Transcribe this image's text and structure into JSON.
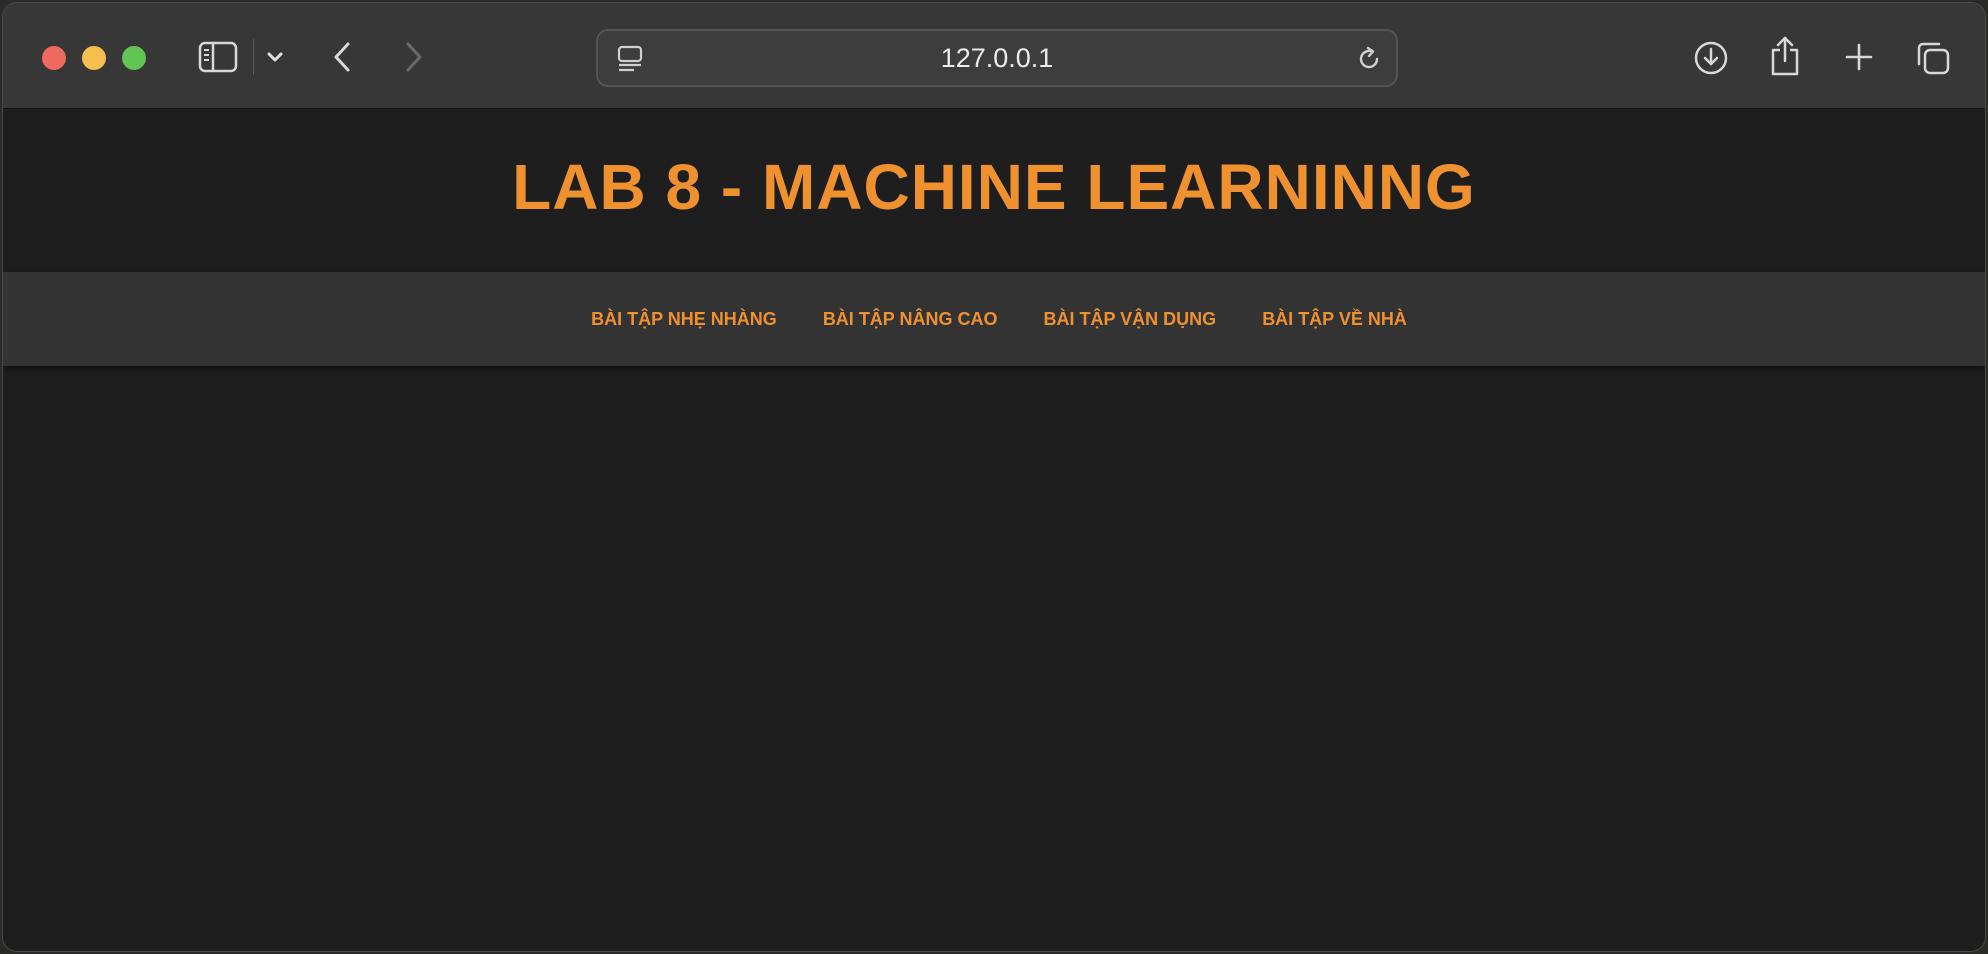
{
  "browser": {
    "url": "127.0.0.1",
    "icons": {
      "sidebar": "sidebar-icon",
      "chevron": "chevron-down-icon",
      "back": "back-arrow-icon",
      "forward": "forward-arrow-icon",
      "page_menu": "page-menu-icon",
      "reload": "reload-icon",
      "download": "download-icon",
      "share": "share-icon",
      "new_tab": "plus-icon",
      "tab_overview": "tab-overview-icon"
    },
    "traffic_lights": {
      "close": "#ed6a5e",
      "minimize": "#f5bf4f",
      "maximize": "#61c554"
    }
  },
  "page": {
    "title": "LAB 8 - MACHINE LEARNINNG",
    "nav": [
      {
        "label": "BÀI TẬP NHẸ NHÀNG"
      },
      {
        "label": "BÀI TẬP NÂNG CAO"
      },
      {
        "label": "BÀI TẬP VẬN DỤNG"
      },
      {
        "label": "BÀI TẬP VỀ NHÀ"
      }
    ],
    "colors": {
      "accent": "#f0912f",
      "background": "#1e1e1e",
      "nav_background": "#333333"
    }
  }
}
